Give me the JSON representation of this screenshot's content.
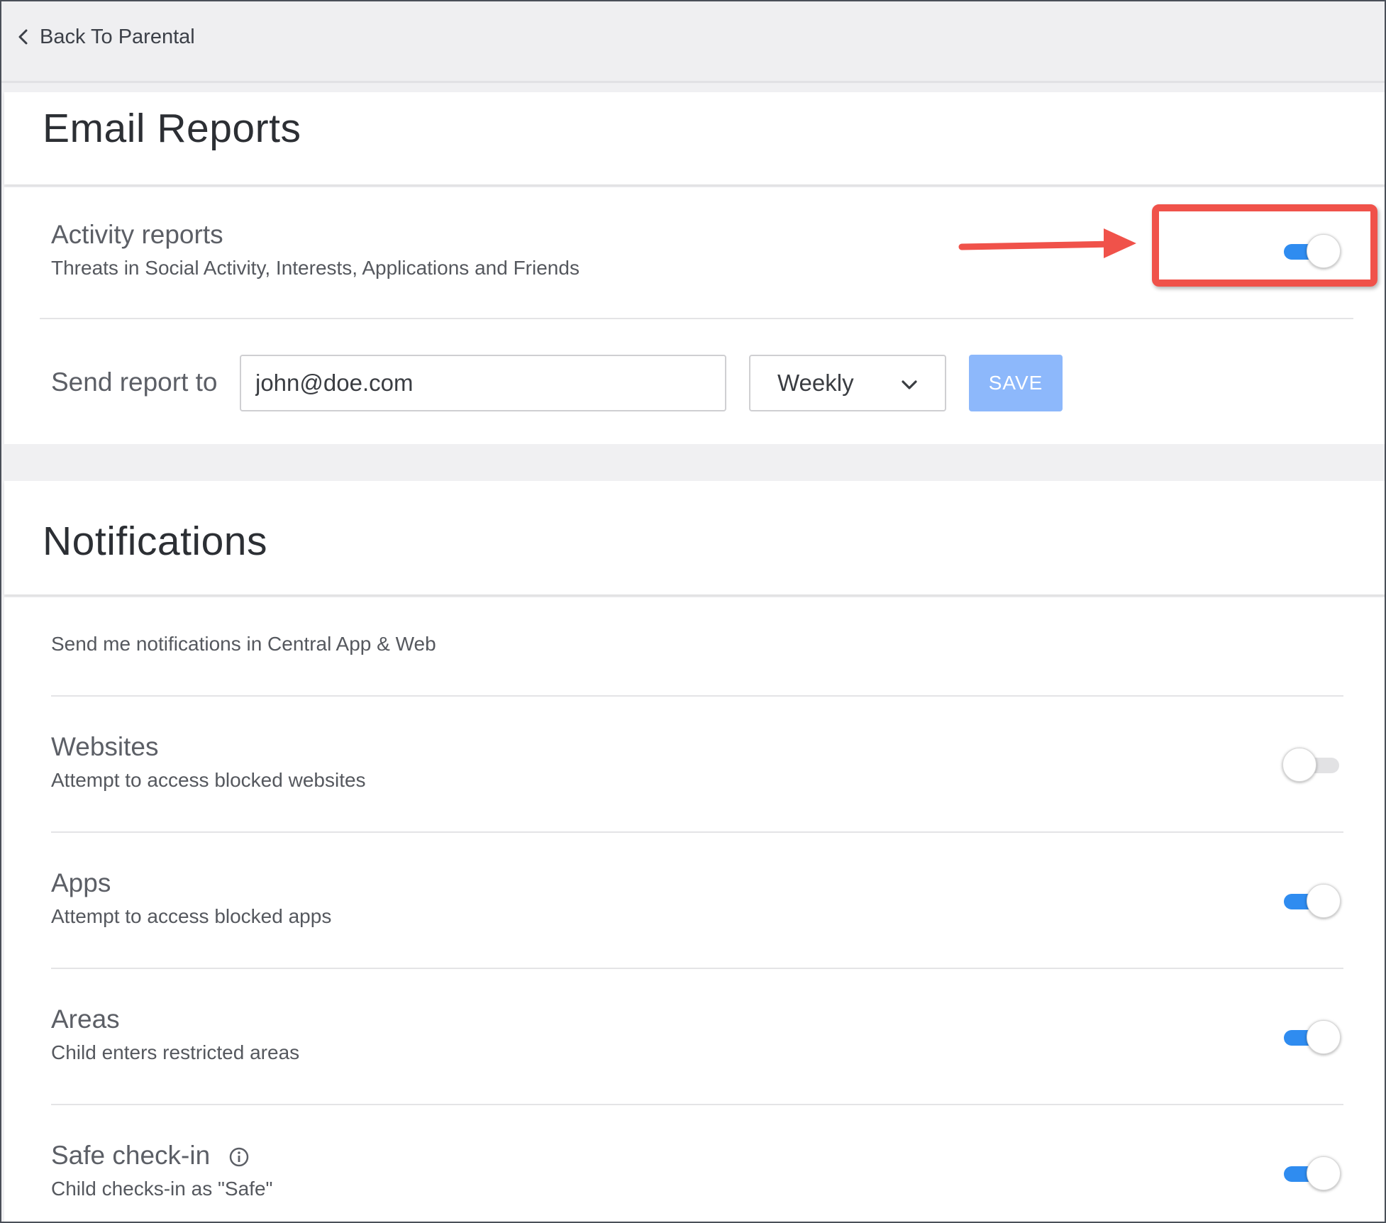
{
  "topbar": {
    "back_label": "Back To Parental"
  },
  "email_reports": {
    "title": "Email Reports",
    "activity": {
      "title": "Activity reports",
      "subtitle": "Threats in Social Activity, Interests, Applications and Friends",
      "enabled": true
    },
    "send_report": {
      "label": "Send report to",
      "email_value": "john@doe.com",
      "frequency": "Weekly",
      "save_label": "SAVE"
    }
  },
  "notifications": {
    "title": "Notifications",
    "intro": "Send me notifications in Central App & Web",
    "items": [
      {
        "title": "Websites",
        "subtitle": "Attempt to access blocked websites",
        "enabled": false
      },
      {
        "title": "Apps",
        "subtitle": "Attempt to access blocked apps",
        "enabled": true
      },
      {
        "title": "Areas",
        "subtitle": "Child enters restricted areas",
        "enabled": true
      },
      {
        "title": "Safe check-in",
        "subtitle": "Child checks-in as \"Safe\"",
        "enabled": true
      }
    ]
  },
  "colors": {
    "accent": "#2f8cf0",
    "save_button": "#8db8fb",
    "annotation": "#f0524a"
  }
}
